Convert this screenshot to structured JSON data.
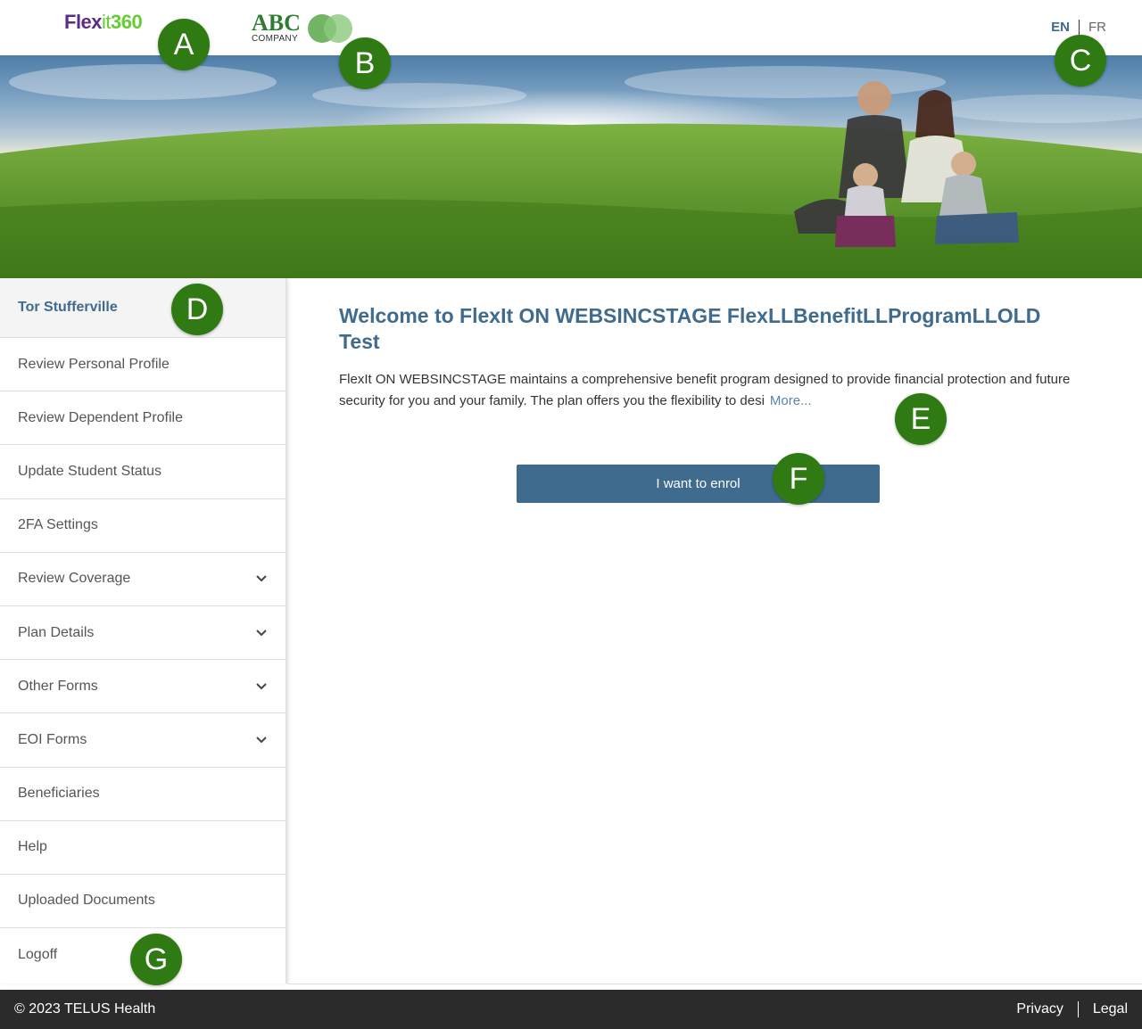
{
  "header": {
    "brand_part1": "Flex",
    "brand_part2": "it",
    "brand_part3": "360",
    "company_name": "ABC",
    "company_sub": "COMPANY",
    "lang_en": "EN",
    "lang_fr": "FR"
  },
  "sidebar": {
    "user_name": "Tor Stufferville",
    "items": [
      {
        "label": "Review Personal Profile",
        "expandable": false
      },
      {
        "label": "Review Dependent Profile",
        "expandable": false
      },
      {
        "label": "Update Student Status",
        "expandable": false
      },
      {
        "label": "2FA Settings",
        "expandable": false
      },
      {
        "label": "Review Coverage",
        "expandable": true
      },
      {
        "label": "Plan Details",
        "expandable": true
      },
      {
        "label": "Other Forms",
        "expandable": true
      },
      {
        "label": "EOI Forms",
        "expandable": true
      },
      {
        "label": "Beneficiaries",
        "expandable": false
      },
      {
        "label": "Help",
        "expandable": false
      },
      {
        "label": "Uploaded Documents",
        "expandable": false
      },
      {
        "label": "Logoff",
        "expandable": false
      }
    ]
  },
  "main": {
    "welcome_title": "Welcome to FlexIt ON WEBSINCSTAGE FlexLLBenefitLLProgramLLOLD Test",
    "intro_text": "FlexIt ON WEBSINCSTAGE maintains a comprehensive benefit program designed to provide financial protection and future security for you and your family.  The plan offers you the flexibility to desi",
    "more_link": "More...",
    "enrol_button": "I want to enrol"
  },
  "footer": {
    "copyright": "© 2023 TELUS Health",
    "privacy": "Privacy",
    "legal": "Legal"
  },
  "markers": [
    "A",
    "B",
    "C",
    "D",
    "E",
    "F",
    "G"
  ],
  "colors": {
    "accent": "#3f6b8e",
    "marker": "#2f7a12",
    "footer_bg": "#2b2b2b"
  }
}
